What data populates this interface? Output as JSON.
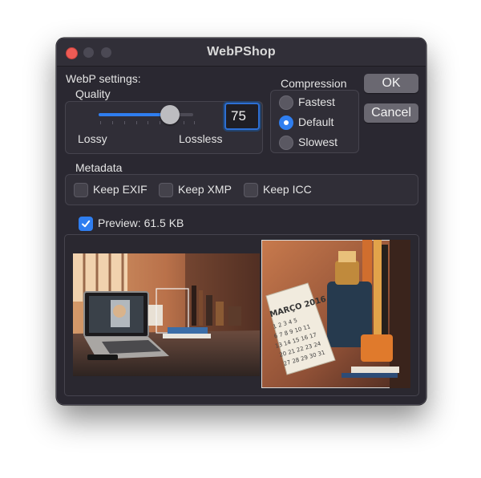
{
  "window": {
    "title": "WebPShop"
  },
  "settings": {
    "section_label": "WebP settings:",
    "quality_label": "Quality",
    "lossy_label": "Lossy",
    "lossless_label": "Lossless",
    "quality_value": "75",
    "quality_slider_fraction": 0.75
  },
  "compression": {
    "label": "Compression",
    "options": [
      "Fastest",
      "Default",
      "Slowest"
    ],
    "selected": "Default"
  },
  "buttons": {
    "ok": "OK",
    "cancel": "Cancel"
  },
  "metadata": {
    "label": "Metadata",
    "options": [
      {
        "label": "Keep EXIF",
        "checked": false
      },
      {
        "label": "Keep XMP",
        "checked": false
      },
      {
        "label": "Keep ICC",
        "checked": false
      }
    ]
  },
  "preview": {
    "label": "Preview: 61.5 KB",
    "checked": true
  },
  "calendar": {
    "header": "MARÇO 2016"
  },
  "colors": {
    "accent": "#2f7ef0",
    "window_bg": "#2a2831",
    "close": "#ee5b55"
  }
}
